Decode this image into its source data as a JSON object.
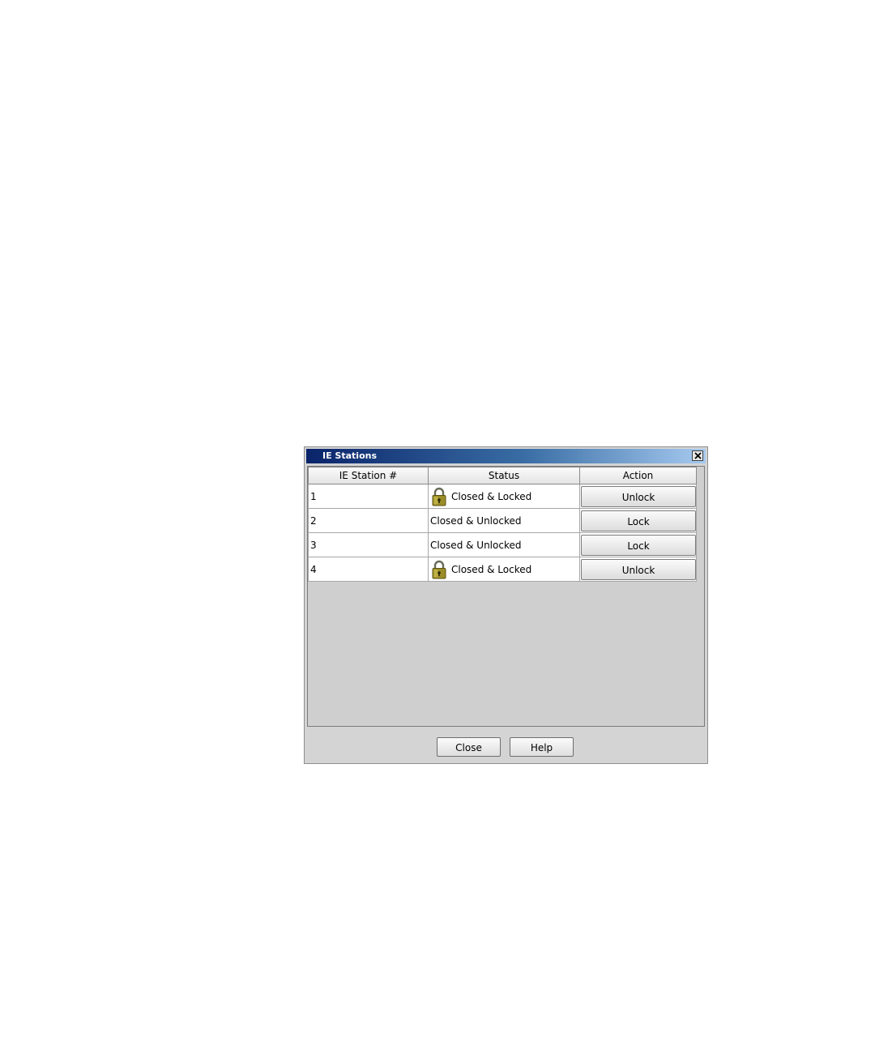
{
  "window": {
    "title": "IE Stations",
    "close_icon": "close-x-icon"
  },
  "table": {
    "headers": [
      "IE Station #",
      "Status",
      "Action"
    ],
    "rows": [
      {
        "station": "1",
        "status": "Closed & Locked",
        "locked": true,
        "action": "Unlock"
      },
      {
        "station": "2",
        "status": "Closed & Unlocked",
        "locked": false,
        "action": "Lock"
      },
      {
        "station": "3",
        "status": "Closed & Unlocked",
        "locked": false,
        "action": "Lock"
      },
      {
        "station": "4",
        "status": "Closed & Locked",
        "locked": true,
        "action": "Unlock"
      }
    ]
  },
  "footer": {
    "close_label": "Close",
    "help_label": "Help"
  },
  "icons": {
    "lock": "padlock-icon"
  },
  "colors": {
    "titlebar_start": "#0a246a",
    "titlebar_end": "#a6caf0",
    "lock_body": "#9a8d28"
  }
}
